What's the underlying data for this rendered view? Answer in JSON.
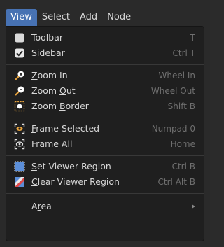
{
  "menubar": {
    "items": [
      "View",
      "Select",
      "Add",
      "Node"
    ]
  },
  "menu": {
    "toolbar": {
      "label": "Toolbar",
      "shortcut": "T",
      "checked": false
    },
    "sidebar": {
      "label": "Sidebar",
      "shortcut": "Ctrl T",
      "checked": true
    },
    "zoom_in": {
      "label_pre": "",
      "label_ul": "Z",
      "label_post": "oom In",
      "shortcut": "Wheel In"
    },
    "zoom_out": {
      "label_pre": "Zoom ",
      "label_ul": "O",
      "label_post": "ut",
      "shortcut": "Wheel Out"
    },
    "zoom_border": {
      "label_pre": "Zoom ",
      "label_ul": "B",
      "label_post": "order",
      "shortcut": "Shift B"
    },
    "frame_selected": {
      "label_pre": "",
      "label_ul": "F",
      "label_post": "rame Selected",
      "shortcut": "Numpad 0"
    },
    "frame_all": {
      "label_pre": "Frame ",
      "label_ul": "A",
      "label_post": "ll",
      "shortcut": "Home"
    },
    "set_viewer_region": {
      "label_pre": "",
      "label_ul": "S",
      "label_post": "et Viewer Region",
      "shortcut": "Ctrl B"
    },
    "clear_viewer_region": {
      "label_pre": "",
      "label_ul": "C",
      "label_post": "lear Viewer Region",
      "shortcut": "Ctrl Alt B"
    },
    "area": {
      "label_pre": "A",
      "label_ul": "r",
      "label_post": "ea"
    }
  },
  "colors": {
    "accent": "#4772b3",
    "menu_bg": "#1f1f1f",
    "shortcut": "#6f6f6f",
    "text": "#d6d6d6"
  },
  "icons": [
    "checkbox-icon",
    "checkbox-checked-icon",
    "zoom-in-icon",
    "zoom-out-icon",
    "zoom-border-icon",
    "frame-selected-icon",
    "frame-all-icon",
    "set-viewer-region-icon",
    "clear-viewer-region-icon",
    "submenu-arrow-icon"
  ]
}
